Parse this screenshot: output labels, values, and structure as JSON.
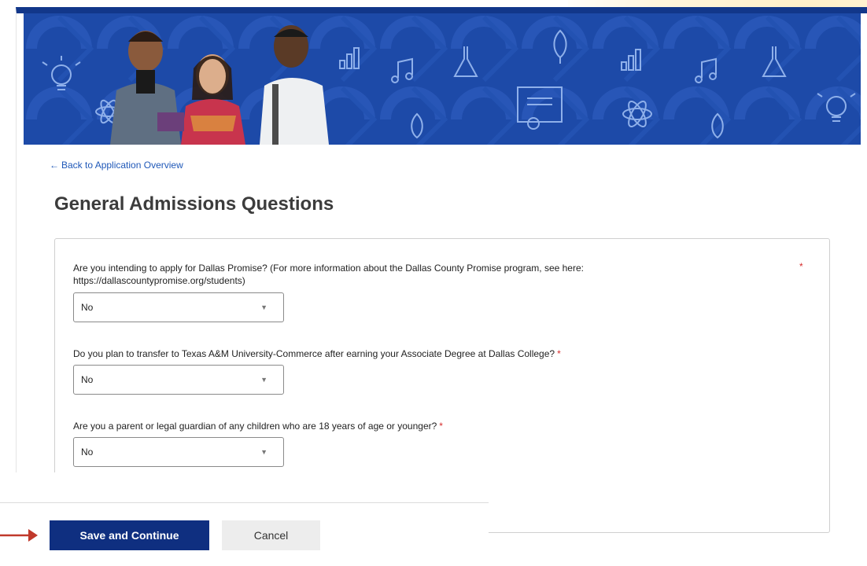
{
  "nav": {
    "back_link_arrow": "←",
    "back_link_label": "Back to Application Overview"
  },
  "page": {
    "title": "General Admissions Questions"
  },
  "questions": [
    {
      "text": "Are you intending to apply for Dallas Promise? (For more information about the Dallas County Promise program, see here: https://dallascountypromise.org/students)",
      "required_marker": "*",
      "selected": "No"
    },
    {
      "text": "Do you plan to transfer to Texas A&M University-Commerce after earning your Associate Degree at Dallas College?",
      "required_marker": "*",
      "selected": "No"
    },
    {
      "text": "Are you a parent or legal guardian of any children who are 18 years of age or younger?",
      "required_marker": "*",
      "selected": "No"
    }
  ],
  "dropdown_caret": "▼",
  "actions": {
    "save_label": "Save and Continue",
    "cancel_label": "Cancel"
  },
  "colors": {
    "brand_blue": "#12378a",
    "button_primary": "#0f2f80",
    "required": "#d62b2b",
    "link": "#1f58b8",
    "annotation_arrow": "#c0392b"
  },
  "icons": {
    "hero_decor": [
      "lightbulb-icon",
      "atom-icon",
      "bar-chart-icon",
      "music-note-icon",
      "flask-icon",
      "leaf-icon",
      "certificate-icon"
    ],
    "annotation": "red-arrow-icon"
  }
}
